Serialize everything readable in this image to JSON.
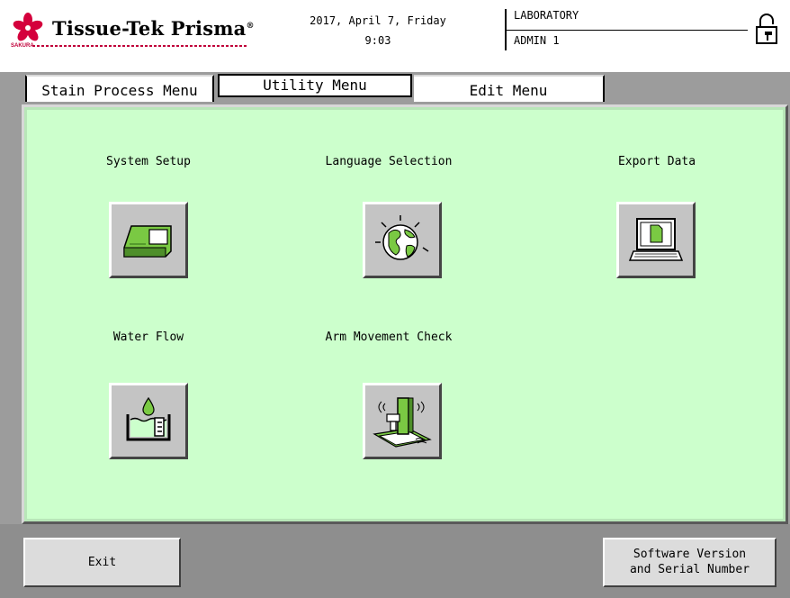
{
  "header": {
    "brand": "Tissue-Tek Prisma",
    "brand_mark": "®",
    "sakura": "SAKURA",
    "date": "2017, April 7, Friday",
    "time": "9:03",
    "user_group": "LABORATORY",
    "user_name": "ADMIN 1"
  },
  "tabs": {
    "stain": "Stain Process Menu",
    "utility": "Utility Menu",
    "edit": "Edit Menu"
  },
  "items": {
    "system_setup": "System Setup",
    "language_selection": "Language Selection",
    "export_data": "Export Data",
    "water_flow": "Water Flow",
    "arm_movement_check": "Arm Movement Check"
  },
  "bottom": {
    "exit": "Exit",
    "version": "Software Version\nand Serial Number"
  },
  "icons": {
    "logo": "sakura-flower-icon",
    "lock": "lock-icon",
    "system_setup": "stainer-machine-icon",
    "language": "globe-icon",
    "export": "laptop-icon",
    "water": "water-tank-icon",
    "arm": "robot-arm-icon"
  },
  "colors": {
    "panel": "#ccffcc",
    "accent_green": "#7ac943",
    "brand_red": "#c0003a"
  }
}
